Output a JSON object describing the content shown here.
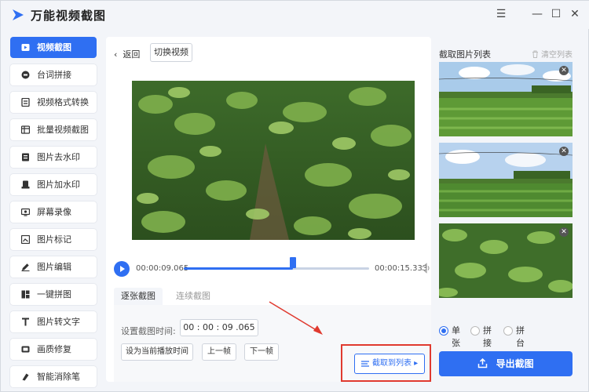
{
  "app": {
    "title": "万能视频截图"
  },
  "window_controls": {
    "menu": "☰",
    "minimize": "—",
    "maximize": "☐",
    "close": "✕"
  },
  "sidebar": {
    "items": [
      {
        "label": "视频截图",
        "icon": "video-screenshot-icon",
        "active": true
      },
      {
        "label": "台词拼接",
        "icon": "subtitle-join-icon"
      },
      {
        "label": "视频格式转换",
        "icon": "format-convert-icon"
      },
      {
        "label": "批量视频截图",
        "icon": "batch-screenshot-icon"
      },
      {
        "label": "图片去水印",
        "icon": "remove-watermark-icon"
      },
      {
        "label": "图片加水印",
        "icon": "add-watermark-icon"
      },
      {
        "label": "屏幕录像",
        "icon": "screen-record-icon"
      },
      {
        "label": "图片标记",
        "icon": "image-mark-icon"
      },
      {
        "label": "图片编辑",
        "icon": "image-edit-icon"
      },
      {
        "label": "一键拼图",
        "icon": "collage-icon"
      },
      {
        "label": "图片转文字",
        "icon": "image-to-text-icon"
      },
      {
        "label": "画质修复",
        "icon": "quality-repair-icon"
      },
      {
        "label": "智能消除笔",
        "icon": "eraser-pen-icon"
      }
    ]
  },
  "main": {
    "back_label": "返回",
    "switch_video_label": "切换视频",
    "player": {
      "current_time": "00:00:09.065",
      "total_time": "00:00:15.333",
      "progress": 0.59
    },
    "tabs": [
      {
        "label": "逐张截图",
        "active": true
      },
      {
        "label": "连续截图",
        "active": false
      }
    ],
    "set_time_label": "设置截图时间:",
    "time_value": "00 : 00 : 09 .065",
    "set_current_label": "设为当前播放时间",
    "prev_frame_label": "上一帧",
    "next_frame_label": "下一帧",
    "capture_label": "截取到列表 ▸"
  },
  "right": {
    "title": "截取图片列表",
    "clear_label": "清空列表",
    "thumb_close": "✕",
    "modes": [
      {
        "label": "单张",
        "selected": true
      },
      {
        "label": "拼接",
        "selected": false
      },
      {
        "label": "拼台词",
        "selected": false
      }
    ],
    "export_label": "导出截图"
  },
  "colors": {
    "accent": "#2f6ff2",
    "annotation": "#e03a2f"
  }
}
